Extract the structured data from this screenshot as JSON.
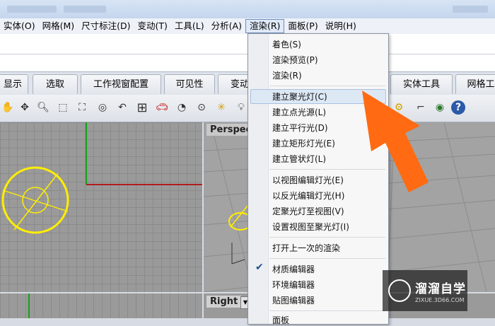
{
  "menubar": {
    "items": [
      "实体(O)",
      "网格(M)",
      "尺寸标注(D)",
      "变动(T)",
      "工具(L)",
      "分析(A)",
      "渲染(R)",
      "面板(P)",
      "说明(H)"
    ]
  },
  "tabs": [
    "显示",
    "选取",
    "工作视窗配置",
    "可见性",
    "变动",
    "实体工具",
    "网格工"
  ],
  "viewports": {
    "perspective_label": "Perspect",
    "right_label": "Right"
  },
  "render_menu": {
    "items": [
      "着色(S)",
      "渲染预览(P)",
      "渲染(R)",
      "建立聚光灯(C)",
      "建立点光源(L)",
      "建立平行光(D)",
      "建立矩形灯光(E)",
      "建立管状灯(L)",
      "以视图编辑灯光(E)",
      "以反光编辑灯光(H)",
      "定聚光灯至视图(V)",
      "设置视图至聚光灯(I)",
      "打开上一次的渲染",
      "材质编辑器",
      "环境编辑器",
      "贴图编辑器",
      "面板"
    ],
    "highlighted": "建立聚光灯(C)",
    "checked": "材质编辑器"
  },
  "toolbar": {
    "icons": [
      "pan-hand-icon",
      "rotate-view-icon",
      "zoom-icon",
      "zoom-window-icon",
      "zoom-extents-icon",
      "zoom-selected-icon",
      "undo-view-icon",
      "four-viewports-icon",
      "car-icon",
      "render-icon",
      "clock-icon",
      "lights-icon",
      "bulb-icon"
    ],
    "right_icons": [
      "gear-cluster-icon",
      "dimension-icon",
      "globe-icon",
      "help-icon"
    ]
  },
  "arrow_color": "#ff6a12",
  "watermark": {
    "title": "溜溜自学",
    "subtitle": "ZIXUE.3D66.COM"
  }
}
